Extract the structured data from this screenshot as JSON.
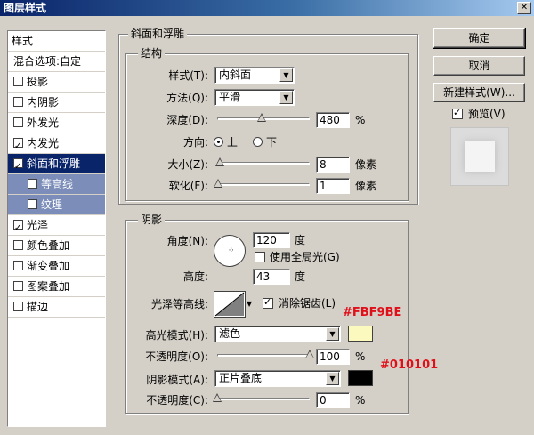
{
  "window": {
    "title": "图层样式"
  },
  "left_list": {
    "header": "样式",
    "items": [
      {
        "label": "混合选项:自定",
        "checkbox": false,
        "checked": false,
        "selected": false,
        "sub": false
      },
      {
        "label": "投影",
        "checkbox": true,
        "checked": false,
        "selected": false,
        "sub": false
      },
      {
        "label": "内阴影",
        "checkbox": true,
        "checked": false,
        "selected": false,
        "sub": false
      },
      {
        "label": "外发光",
        "checkbox": true,
        "checked": false,
        "selected": false,
        "sub": false
      },
      {
        "label": "内发光",
        "checkbox": true,
        "checked": true,
        "selected": false,
        "sub": false
      },
      {
        "label": "斜面和浮雕",
        "checkbox": true,
        "checked": true,
        "selected": true,
        "sub": false
      },
      {
        "label": "等高线",
        "checkbox": true,
        "checked": false,
        "selected": false,
        "sub": true
      },
      {
        "label": "纹理",
        "checkbox": true,
        "checked": false,
        "selected": false,
        "sub": true
      },
      {
        "label": "光泽",
        "checkbox": true,
        "checked": true,
        "selected": false,
        "sub": false
      },
      {
        "label": "颜色叠加",
        "checkbox": true,
        "checked": false,
        "selected": false,
        "sub": false
      },
      {
        "label": "渐变叠加",
        "checkbox": true,
        "checked": false,
        "selected": false,
        "sub": false
      },
      {
        "label": "图案叠加",
        "checkbox": true,
        "checked": false,
        "selected": false,
        "sub": false
      },
      {
        "label": "描边",
        "checkbox": true,
        "checked": false,
        "selected": false,
        "sub": false
      }
    ]
  },
  "bevel": {
    "title": "斜面和浮雕",
    "structure_title": "结构",
    "style_label": "样式(T):",
    "style_value": "内斜面",
    "technique_label": "方法(Q):",
    "technique_value": "平滑",
    "depth_label": "深度(D):",
    "depth_value": "480",
    "depth_unit": "%",
    "depth_level": 0.48,
    "direction_label": "方向:",
    "dir_up": "上",
    "dir_down": "下",
    "size_label": "大小(Z):",
    "size_value": "8",
    "size_unit": "像素",
    "size_level": 0.03,
    "soften_label": "软化(F):",
    "soften_value": "1",
    "soften_unit": "像素",
    "soften_level": 0.01
  },
  "shading": {
    "title": "阴影",
    "angle_label": "角度(N):",
    "angle_value": "120",
    "angle_unit": "度",
    "global_light_label": "使用全局光(G)",
    "global_light_checked": false,
    "altitude_label": "高度:",
    "altitude_value": "43",
    "altitude_unit": "度",
    "gloss_label": "光泽等高线:",
    "antialias_label": "消除锯齿(L)",
    "antialias_checked": true,
    "highlight_label": "高光模式(H):",
    "highlight_value": "滤色",
    "highlight_color": "#FBF9BE",
    "highlight_opacity_label": "不透明度(O):",
    "highlight_opacity_value": "100",
    "highlight_opacity_unit": "%",
    "highlight_opacity_level": 1.0,
    "shadow_label": "阴影模式(A):",
    "shadow_value": "正片叠底",
    "shadow_color": "#010101",
    "shadow_opacity_label": "不透明度(C):",
    "shadow_opacity_value": "0",
    "shadow_opacity_unit": "%",
    "shadow_opacity_level": 0.0
  },
  "buttons": {
    "ok": "确定",
    "cancel": "取消",
    "new_style": "新建样式(W)..."
  },
  "preview": {
    "label": "预览(V)",
    "checked": true
  },
  "annotations": {
    "highlight": "#FBF9BE",
    "shadow": "#010101"
  }
}
